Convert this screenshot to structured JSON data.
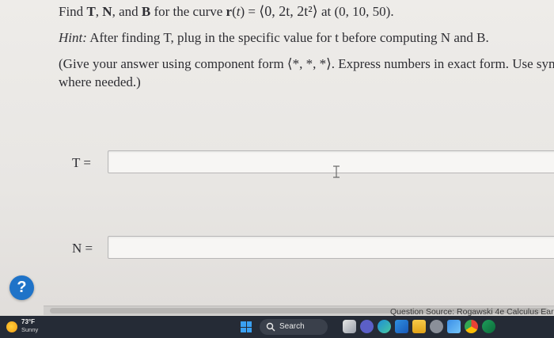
{
  "problem": {
    "prefix": "Find",
    "t_symbol": "T",
    "sep1": ", ",
    "n_symbol": "N",
    "and_word": ", and",
    "b_symbol": "B",
    "for_curve": "for the curve",
    "r_func": "r",
    "t_var": "t",
    "equals": "=",
    "vector_expr": "⟨0, 2t, 2t²⟩",
    "at_word": "at",
    "point": "(0, 10, 50)."
  },
  "hint": {
    "label": "Hint:",
    "text": "After finding T, plug in the specific value for t before computing N and B."
  },
  "note": {
    "line1": "(Give your answer using component form ⟨*, *, *⟩. Express numbers in exact form. Use sym",
    "line2": "where needed.)"
  },
  "answers": {
    "t_label": "T =",
    "t_value": "",
    "n_label": "N =",
    "n_value": ""
  },
  "help": {
    "label": "?"
  },
  "source": {
    "text": "Question Source: Rogawski 4e Calculus Ear"
  },
  "taskbar": {
    "temperature": "73°F",
    "condition": "Sunny",
    "search_label": "Search",
    "icons": [
      "start-icon",
      "search-icon",
      "task-view-icon",
      "chat-icon",
      "edge-icon",
      "store-icon",
      "explorer-icon",
      "settings-icon",
      "photos-icon",
      "chrome-icon",
      "app-icon"
    ]
  },
  "colors": {
    "page_bg": "#e8e6e3",
    "text": "#2e2e33",
    "help_blue": "#1f73c8",
    "taskbar_bg": "#252b36",
    "weather_sun": "#f29a12"
  }
}
